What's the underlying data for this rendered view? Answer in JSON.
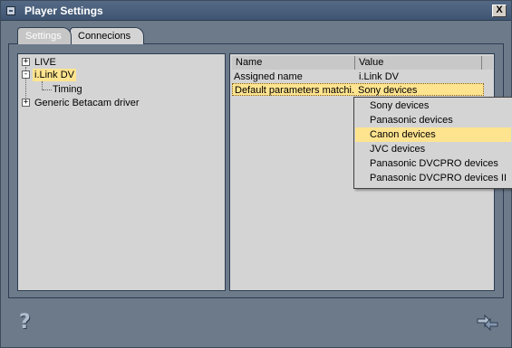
{
  "window": {
    "title": "Player Settings",
    "close_label": "X"
  },
  "tabs": [
    {
      "label": "Settings"
    },
    {
      "label": "Connecions"
    }
  ],
  "tree": {
    "items": [
      {
        "label": "LIVE",
        "expander": "+"
      },
      {
        "label": "i.Link DV",
        "expander": "-"
      },
      {
        "label": "Timing"
      },
      {
        "label": "Generic Betacam driver",
        "expander": "+"
      }
    ]
  },
  "grid": {
    "columns": [
      "Name",
      "Value"
    ],
    "rows": [
      {
        "name": "Assigned name",
        "value": "i.Link DV"
      },
      {
        "name": "Default parameters matchi...",
        "value": "Sony devices"
      }
    ]
  },
  "dropdown": {
    "options": [
      "Sony devices",
      "Panasonic devices",
      "Canon devices",
      "JVC devices",
      "Panasonic DVCPRO devices",
      "Panasonic DVCPRO devices II"
    ],
    "highlighted": "Canon devices"
  },
  "footer": {
    "help_icon": "question-mark",
    "transfer_icon": "transfer-arrows"
  }
}
